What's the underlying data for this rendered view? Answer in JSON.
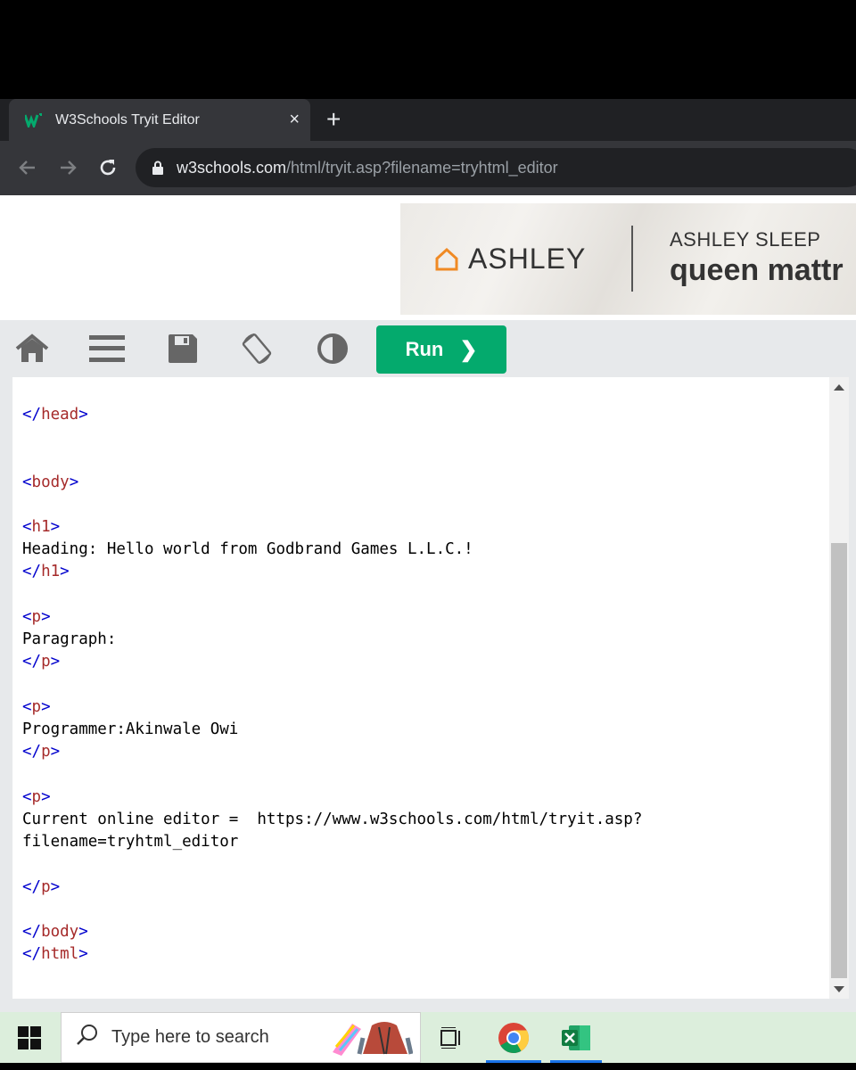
{
  "browser": {
    "tab_title": "W3Schools Tryit Editor",
    "tab_close": "×",
    "new_tab": "+",
    "url_host": "w3schools.com",
    "url_path": "/html/tryit.asp?filename=tryhtml_editor"
  },
  "ad": {
    "brand": "ASHLEY",
    "line1": "ASHLEY SLEEP",
    "line2": "queen mattr"
  },
  "editor": {
    "run_label": "Run",
    "run_chevron": "❯",
    "icons": [
      "home-icon",
      "menu-icon",
      "save-icon",
      "rotate-icon",
      "contrast-icon"
    ]
  },
  "code": {
    "head_close": "head",
    "body_open": "body",
    "h1_open": "h1",
    "heading_text": "Heading: Hello world from Godbrand Games L.L.C.!",
    "h1_close": "h1",
    "p1_open": "p",
    "paragraph_text": "Paragraph:",
    "p1_close": "p",
    "p2_open": "p",
    "programmer_text": "Programmer:Akinwale Owi",
    "p2_close": "p",
    "p3_open": "p",
    "editor_text_1": "Current online editor =  https://www.w3schools.com/html/tryit.asp?",
    "editor_text_2": "filename=tryhtml_editor",
    "p3_close": "p",
    "body_close": "body",
    "html_close": "html"
  },
  "taskbar": {
    "search_placeholder": "Type here to search"
  },
  "colors": {
    "run_green": "#04aa6d",
    "tag_brown": "#a52a2a",
    "bracket_blue": "#0000cd"
  }
}
